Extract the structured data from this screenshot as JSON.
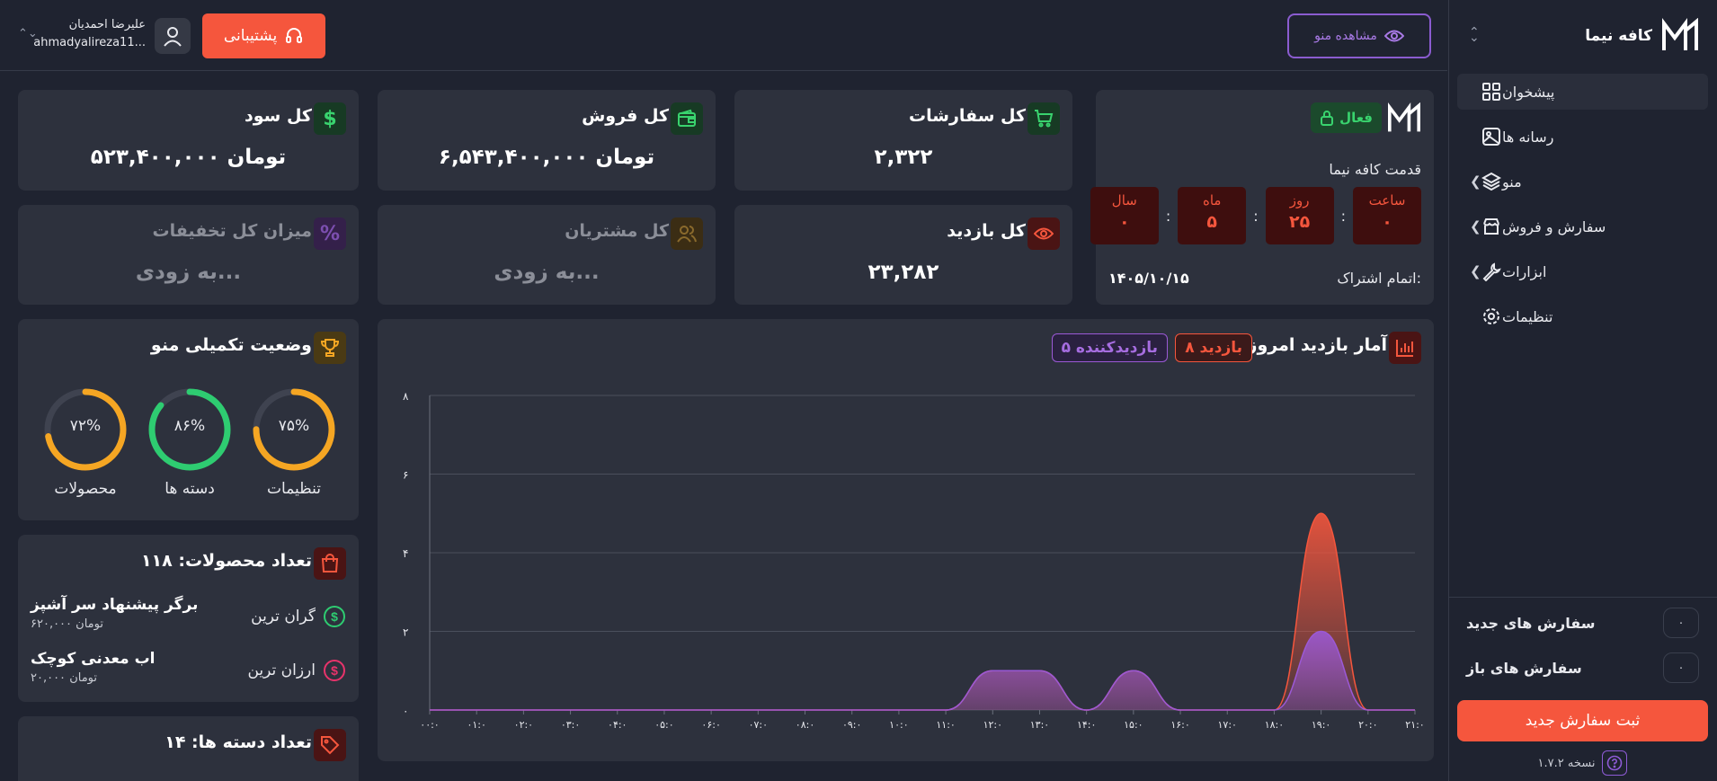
{
  "sidebar": {
    "brand": "کافه نیما",
    "items": [
      {
        "label": "پیشخوان",
        "icon": "dashboard-grid-icon"
      },
      {
        "label": "رسانه ها",
        "icon": "image-icon"
      },
      {
        "label": "منو",
        "icon": "layers-icon"
      },
      {
        "label": "سفارش و فروش",
        "icon": "store-icon"
      },
      {
        "label": "ابزارات",
        "icon": "wrench-icon"
      },
      {
        "label": "تنظیمات",
        "icon": "gear-icon"
      }
    ],
    "new_orders_label": "سفارش های جدید",
    "new_orders_count": "۰",
    "open_orders_label": "سفارش های باز",
    "open_orders_count": "۰",
    "new_order_button": "ثبت سفارش جدید",
    "version": "نسخه ۱.۷.۲"
  },
  "topbar": {
    "view_menu": "مشاهده منو",
    "support": "پشتیبانی",
    "user_name": "علیرضا احمدیان",
    "user_email": "ahmadyalireza11..."
  },
  "subscription": {
    "status": "فعال",
    "since_label": "قدمت کافه نیما",
    "countdown": [
      {
        "unit": "سال",
        "value": "۰"
      },
      {
        "unit": "ماه",
        "value": "۵"
      },
      {
        "unit": "روز",
        "value": "۲۵"
      },
      {
        "unit": "ساعت",
        "value": "۰"
      }
    ],
    "end_label": "اتمام اشتراک:",
    "end_date": "۱۴۰۵/۱۰/۱۵"
  },
  "stats": {
    "orders": {
      "title": "کل سفارشات",
      "value": "۲,۳۲۲"
    },
    "sales": {
      "title": "کل فروش",
      "value": "۶,۵۴۳,۴۰۰,۰۰۰ تومان"
    },
    "profit": {
      "title": "کل سود",
      "value": "۵۲۳,۴۰۰,۰۰۰ تومان"
    },
    "visits": {
      "title": "کل بازدید",
      "value": "۲۳,۲۸۲"
    },
    "customers": {
      "title": "کل مشتریان",
      "value": "به زودی..."
    },
    "discounts": {
      "title": "میزان کل تخفیفات",
      "value": "به زودی..."
    }
  },
  "chart_card": {
    "title": "آمار بازدید امروز",
    "visits_badge": "۸ بازدید",
    "visitors_badge": "۵ بازدیدکننده"
  },
  "chart_data": {
    "type": "area",
    "x": [
      "۰۰:۰",
      "۰۱:۰",
      "۰۲:۰",
      "۰۳:۰",
      "۰۴:۰",
      "۰۵:۰",
      "۰۶:۰",
      "۰۷:۰",
      "۰۸:۰",
      "۰۹:۰",
      "۱۰:۰",
      "۱۱:۰",
      "۱۲:۰",
      "۱۳:۰",
      "۱۴:۰",
      "۱۵:۰",
      "۱۶:۰",
      "۱۷:۰",
      "۱۸:۰",
      "۱۹:۰",
      "۲۰:۰",
      "۲۱:۰"
    ],
    "series": [
      {
        "color": "#f5563d",
        "values": [
          0,
          0,
          0,
          0,
          0,
          0,
          0,
          0,
          0,
          0,
          0,
          0,
          1,
          1,
          0,
          1,
          0,
          0,
          0,
          5,
          0,
          0
        ]
      },
      {
        "color": "#9b59d6",
        "values": [
          0,
          0,
          0,
          0,
          0,
          0,
          0,
          0,
          0,
          0,
          0,
          0,
          1,
          1,
          0,
          1,
          0,
          0,
          0,
          2,
          0,
          0
        ]
      }
    ],
    "yticks": [
      "۰",
      "۲",
      "۴",
      "۶",
      "۸"
    ],
    "ylim": [
      0,
      8
    ],
    "grid": true
  },
  "menu_status": {
    "title": "وضعیت تکمیلی منو",
    "rings": [
      {
        "label": "تنظیمات",
        "pct_text": "۷۵%",
        "value": 75,
        "color": "#f5a623"
      },
      {
        "label": "دسته ها",
        "pct_text": "۸۶%",
        "value": 86,
        "color": "#2ecc71"
      },
      {
        "label": "محصولات",
        "pct_text": "۷۲%",
        "value": 72,
        "color": "#f5a623"
      }
    ]
  },
  "products": {
    "title": "تعداد محصولات: ۱۱۸",
    "expensive_label": "گران ترین",
    "expensive_name": "برگر پیشنهاد سر آشپز",
    "expensive_price": "۶۲۰,۰۰۰ تومان",
    "cheap_label": "ارزان ترین",
    "cheap_name": "اب معدنی کوچک",
    "cheap_price": "۲۰,۰۰۰ تومان"
  },
  "categories": {
    "title": "تعداد دسته ها: ۱۴"
  }
}
